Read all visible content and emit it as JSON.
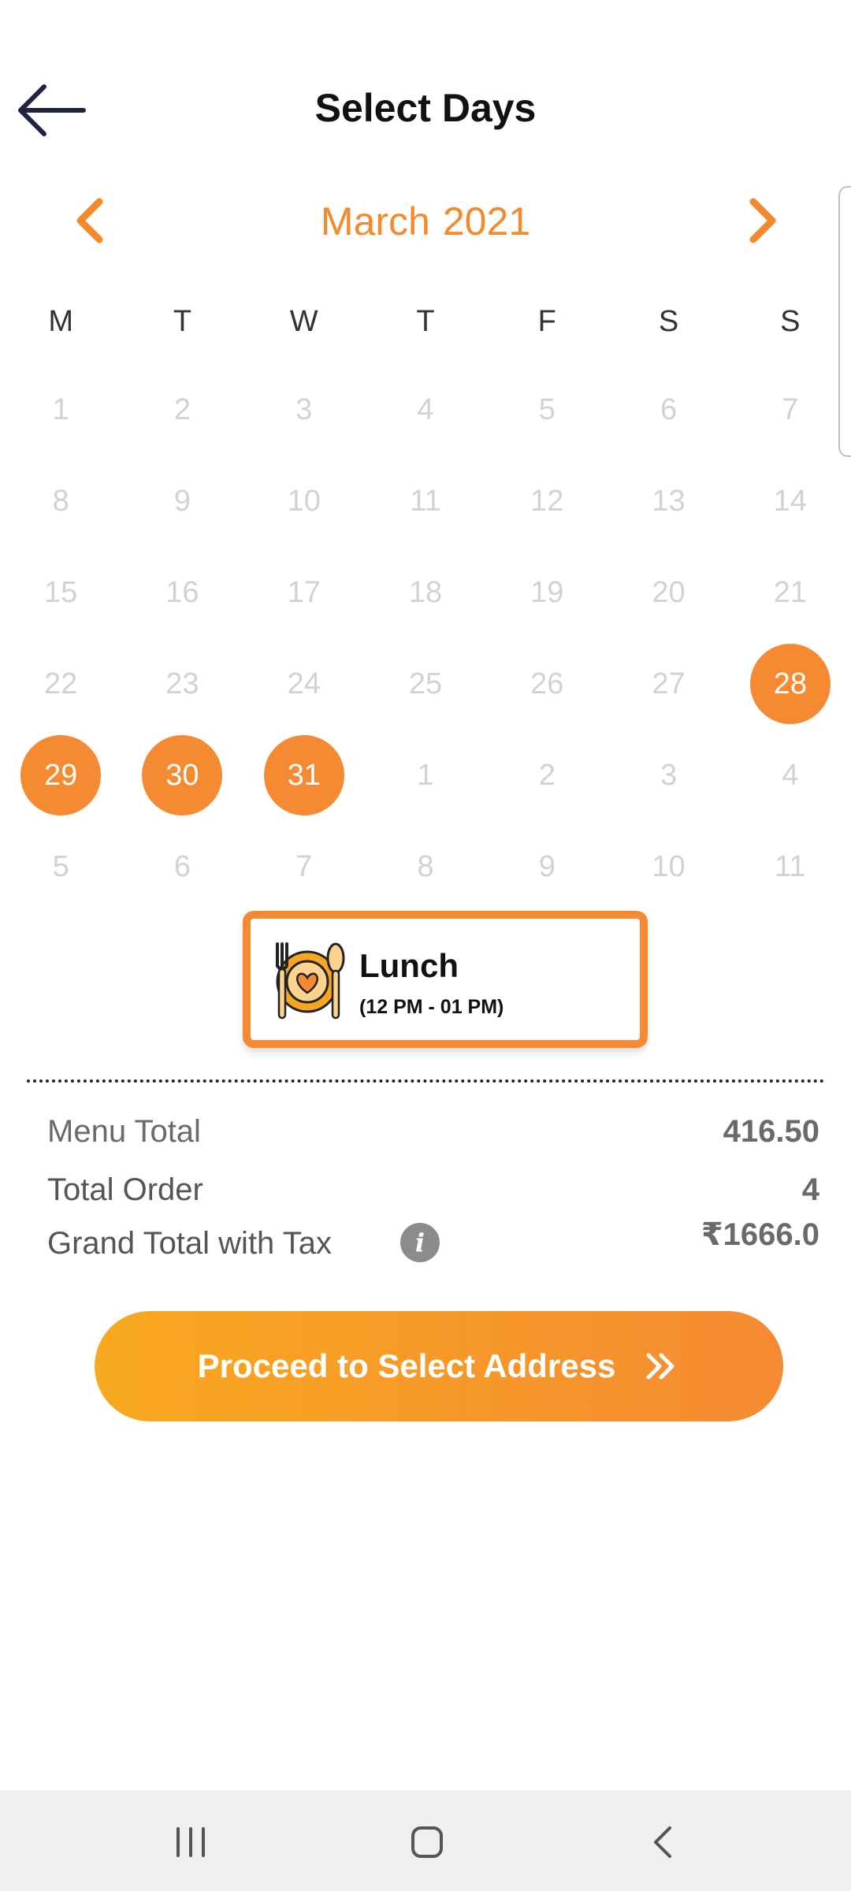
{
  "header": {
    "title": "Select Days"
  },
  "calendar": {
    "month": "March",
    "year": "2021",
    "weekdays": [
      "M",
      "T",
      "W",
      "T",
      "F",
      "S",
      "S"
    ],
    "weeks": [
      [
        "1",
        "2",
        "3",
        "4",
        "5",
        "6",
        "7"
      ],
      [
        "8",
        "9",
        "10",
        "11",
        "12",
        "13",
        "14"
      ],
      [
        "15",
        "16",
        "17",
        "18",
        "19",
        "20",
        "21"
      ],
      [
        "22",
        "23",
        "24",
        "25",
        "26",
        "27",
        "28"
      ],
      [
        "29",
        "30",
        "31",
        "1",
        "2",
        "3",
        "4"
      ],
      [
        "5",
        "6",
        "7",
        "8",
        "9",
        "10",
        "11"
      ]
    ],
    "accent": "#F58A32"
  },
  "meal": {
    "title": "Lunch",
    "time": "(12 PM - 01 PM)"
  },
  "totals": {
    "menu_total_label": "Menu Total",
    "menu_total_value": "416.50",
    "total_order_label": "Total Order",
    "total_order_value": "4",
    "grand_total_label": "Grand Total with Tax",
    "grand_total_value": "₹1666.0"
  },
  "cta": {
    "label": "Proceed to Select Address"
  },
  "icons": {
    "back": "arrow-left-icon",
    "prev": "chevron-left-icon",
    "next": "chevron-right-icon",
    "info": "info-icon",
    "meal": "plate-fork-spoon-icon",
    "cta": "double-chevron-right-icon"
  }
}
